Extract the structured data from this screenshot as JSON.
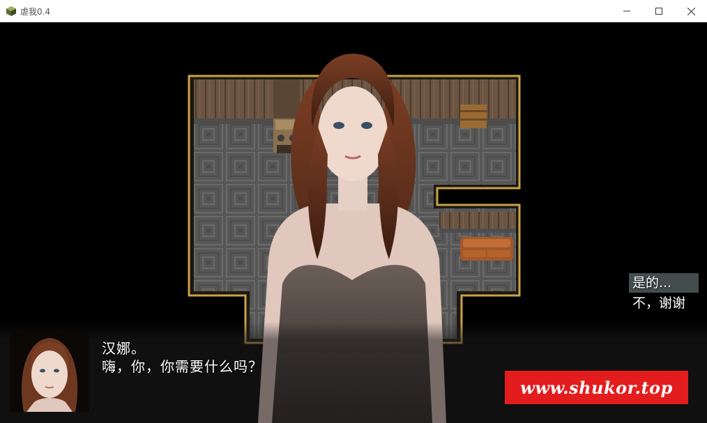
{
  "window": {
    "title": "虐我0.4",
    "minimize_icon": "minimize-icon",
    "maximize_icon": "maximize-icon",
    "close_icon": "close-icon"
  },
  "dialogue": {
    "speaker": "汉娜。",
    "text": "嗨，你，你需要什么吗？"
  },
  "choices": [
    {
      "label": "是的...",
      "selected": true
    },
    {
      "label": "不，谢谢",
      "selected": false
    }
  ],
  "watermark": "www.shukor.top",
  "colors": {
    "watermark_bg": "#e31d1d",
    "wall_trim": "#c9a24a",
    "floor": "#5d5d5d"
  }
}
